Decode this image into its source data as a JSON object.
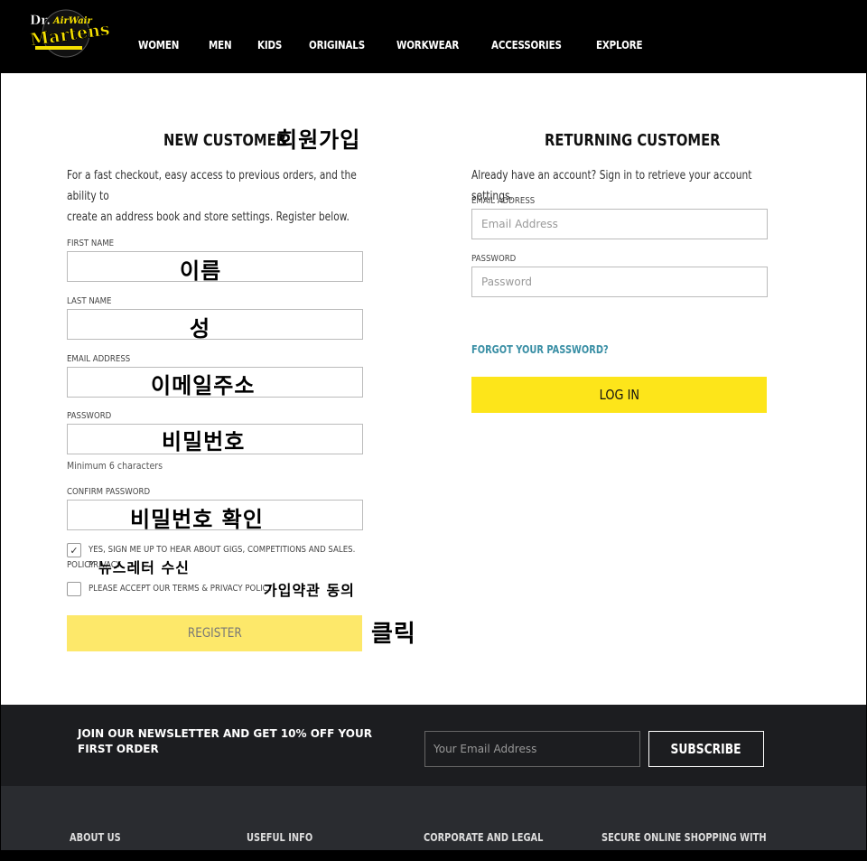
{
  "brand": {
    "logo_text_1": "Dr.",
    "logo_text_2": "Martens",
    "logo_text_3": "AirWair"
  },
  "nav": {
    "items": [
      "WOMEN",
      "MEN",
      "KIDS",
      "ORIGINALS",
      "WORKWEAR",
      "ACCESSORIES",
      "EXPLORE"
    ]
  },
  "new_customer": {
    "title": "NEW CUSTOMER",
    "title_note": "회원가입",
    "intro_line1": "For a fast checkout, easy access to previous orders, and the ability to",
    "intro_line2": "create an address book and store settings. Register below.",
    "first_name": {
      "label": "FIRST NAME",
      "note": "이름"
    },
    "last_name": {
      "label": "LAST NAME",
      "note": "성"
    },
    "email": {
      "label": "EMAIL ADDRESS",
      "note": "이메일주소"
    },
    "password": {
      "label": "PASSWORD",
      "note": "비밀번호",
      "hint": "Minimum 6 characters"
    },
    "confirm_password": {
      "label": "CONFIRM PASSWORD",
      "note": "비밀번호 확인"
    },
    "newsletter_consent": {
      "text_line1": "YES, SIGN ME UP TO HEAR ABOUT GIGS, COMPETITIONS AND SALES. PRIVACY",
      "text_line2": "POLICY",
      "note": "뉴스레터 수신",
      "checked": true
    },
    "terms_consent": {
      "text": "PLEASE ACCEPT OUR TERMS & PRIVACY POLICY",
      "note": "가입약관 동의",
      "checked": false
    },
    "register_label": "REGISTER",
    "register_note": "클릭"
  },
  "returning_customer": {
    "title": "RETURNING CUSTOMER",
    "intro": "Already have an account? Sign in to retrieve your account settings.",
    "email": {
      "label": "EMAIL ADDRESS",
      "placeholder": "Email Address"
    },
    "password": {
      "label": "PASSWORD",
      "placeholder": "Password"
    },
    "forgot_label": "FORGOT YOUR PASSWORD?",
    "login_label": "LOG IN"
  },
  "newsletter": {
    "text": "JOIN OUR NEWSLETTER AND GET 10% OFF YOUR FIRST ORDER",
    "placeholder": "Your Email Address",
    "button": "SUBSCRIBE"
  },
  "footer": {
    "columns": [
      "ABOUT US",
      "USEFUL INFO",
      "CORPORATE AND LEGAL",
      "SECURE ONLINE SHOPPING WITH"
    ]
  },
  "colors": {
    "accent_yellow": "#fde51a",
    "link_teal": "#3a8fa5",
    "header_bg": "#000000"
  }
}
